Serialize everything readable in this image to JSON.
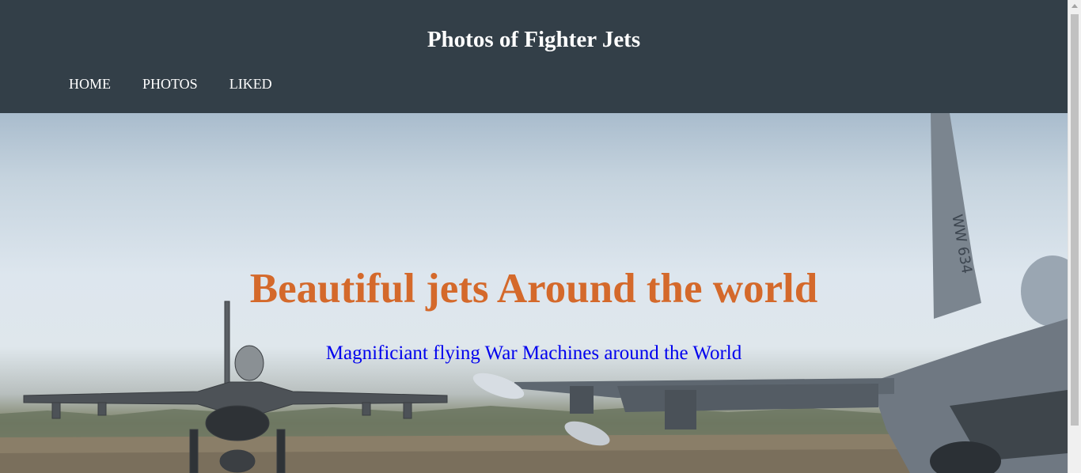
{
  "header": {
    "title": "Photos of Fighter Jets",
    "nav": [
      {
        "label": "HOME"
      },
      {
        "label": "PHOTOS"
      },
      {
        "label": "LIKED"
      }
    ]
  },
  "hero": {
    "heading": "Beautiful jets Around the world",
    "subheading": "Magnificiant flying War Machines around the World",
    "tail_marking": "WW 634"
  },
  "colors": {
    "header_bg": "#333f48",
    "heading": "#d4692b",
    "subheading": "#0000ee",
    "nav_text": "#ffffff"
  }
}
